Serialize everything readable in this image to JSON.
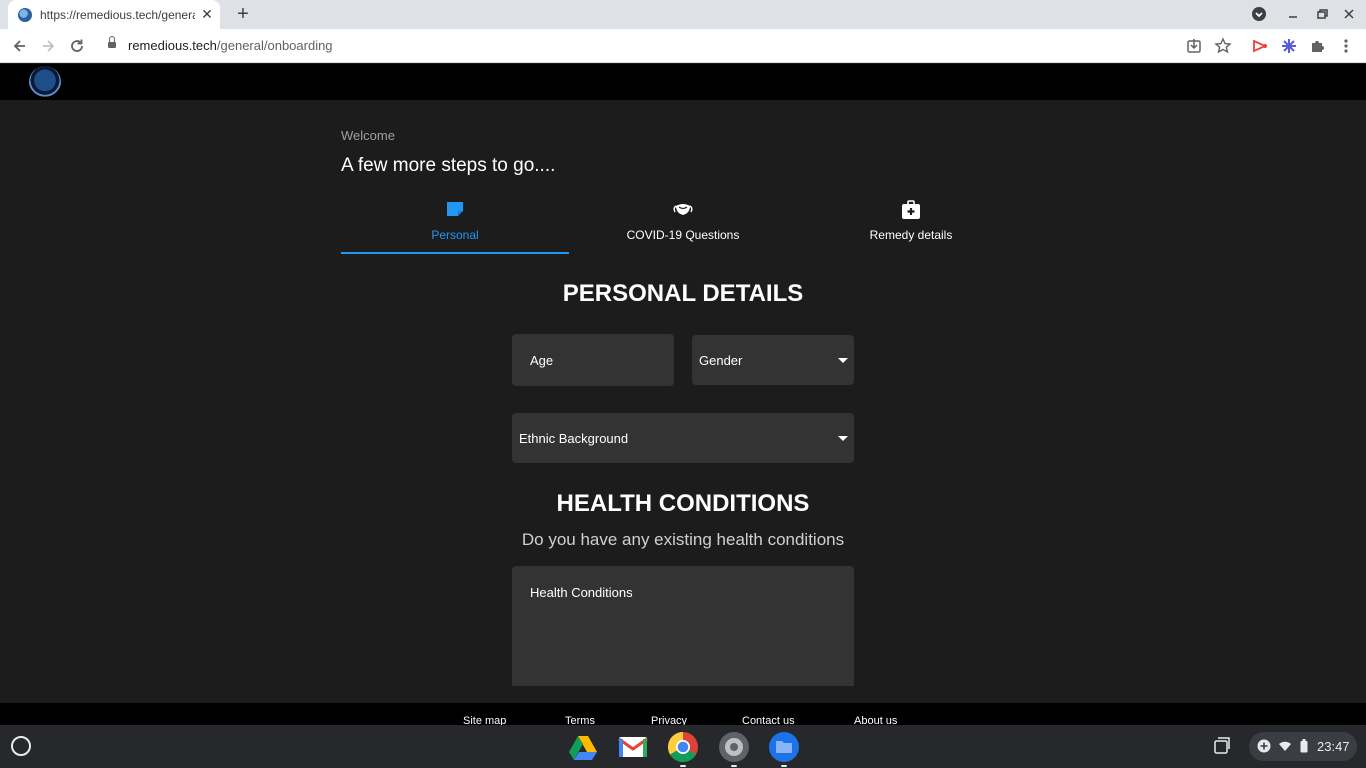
{
  "browser": {
    "tab_title": "https://remedious.tech/general/o",
    "url_host": "remedious.tech",
    "url_path": "/general/onboarding"
  },
  "page": {
    "welcome": "Welcome",
    "headline": "A few more steps to go....",
    "steps": [
      {
        "label": "Personal",
        "icon": "document-icon",
        "active": true
      },
      {
        "label": "COVID-19 Questions",
        "icon": "mask-icon",
        "active": false
      },
      {
        "label": "Remedy details",
        "icon": "medical-kit-icon",
        "active": false
      }
    ],
    "personal_title": "PERSONAL DETAILS",
    "age_label": "Age",
    "gender_label": "Gender",
    "ethnic_label": "Ethnic Background",
    "health_title": "HEALTH CONDITIONS",
    "health_question": "Do you have any existing health conditions",
    "health_field_label": "Health Conditions",
    "accent_color": "#2196f3"
  },
  "footer": {
    "links": [
      "Site map",
      "Terms",
      "Privacy",
      "Contact us",
      "About us"
    ]
  },
  "shelf": {
    "apps": [
      "google-drive-icon",
      "gmail-icon",
      "chrome-icon",
      "settings-icon",
      "files-icon"
    ],
    "time": "23:47"
  }
}
